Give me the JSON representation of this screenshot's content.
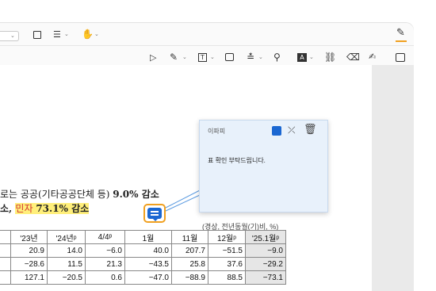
{
  "toolbar_top": {
    "icons": [
      "dropdown",
      "fit-page-icon",
      "view-layout-icon",
      "hand-tool-icon",
      "edit-icon"
    ]
  },
  "toolbar_annot": {
    "icons": [
      "select-arrow-icon",
      "pen-icon",
      "text-box-icon",
      "comment-icon",
      "strike-icon",
      "stamp-icon",
      "highlight-text-icon",
      "link-icon",
      "eraser-icon",
      "signature-icon",
      "sidebar-toggle-icon"
    ]
  },
  "document": {
    "line1_pre": "로는 공공(기타공공단체 등) ",
    "line1_bold": "9.0% 감소",
    "line2_a": "소, ",
    "line2_red": "민자",
    "line2_b": " ",
    "line2_bold": "73.1% 감소",
    "table_caption": "(경상, 전년동월(기)비, %)",
    "table": {
      "headers": [
        "",
        "'23년",
        "'24년ᵖ",
        "4/4ᵖ",
        "1월",
        "11월",
        "12월ᵖ",
        "'25.1월ᵖ"
      ],
      "rows": [
        [
          "",
          "20.9",
          "14.0",
          "−6.0",
          "40.0",
          "207.7",
          "−51.5",
          "−9.0"
        ],
        [
          "",
          "−28.6",
          "11.5",
          "21.3",
          "−43.5",
          "25.8",
          "37.6",
          "−29.2"
        ],
        [
          "",
          "127.1",
          "−20.5",
          "0.6",
          "−47.0",
          "−88.9",
          "88.5",
          "−73.1"
        ]
      ]
    }
  },
  "comment": {
    "author": "이파피",
    "text": "표 확인 부탁드립니다.",
    "color": "#1a67d2"
  }
}
